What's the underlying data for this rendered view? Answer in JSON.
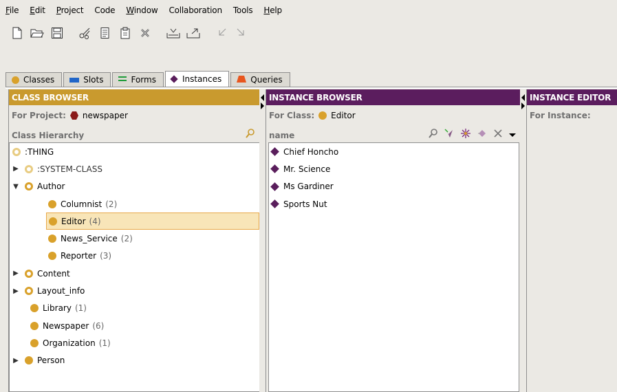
{
  "menu": [
    "File",
    "Edit",
    "Project",
    "Code",
    "Window",
    "Collaboration",
    "Tools",
    "Help"
  ],
  "toolbar_icons": [
    "new-file-icon",
    "open-folder-icon",
    "save-icon",
    "cut-icon",
    "copy-icon",
    "paste-icon",
    "delete-icon",
    "import-icon",
    "export-icon",
    "undo-icon",
    "redo-icon"
  ],
  "tabs": [
    {
      "label": "Classes",
      "icon": "class-dot",
      "active": false
    },
    {
      "label": "Slots",
      "icon": "slot-bar",
      "active": false
    },
    {
      "label": "Forms",
      "icon": "form-lines",
      "active": false
    },
    {
      "label": "Instances",
      "icon": "instance-diamond",
      "active": true
    },
    {
      "label": "Queries",
      "icon": "query-triangle",
      "active": false
    }
  ],
  "class_browser": {
    "header": "CLASS BROWSER",
    "project_label": "For Project:",
    "project_name": "newspaper",
    "hierarchy_label": "Class Hierarchy",
    "header_color": "#c99a2e",
    "rows": [
      {
        "label": ":THING",
        "count": ""
      },
      {
        "label": ":SYSTEM-CLASS",
        "count": ""
      },
      {
        "label": "Author",
        "count": ""
      },
      {
        "label": "Columnist",
        "count": "(2)"
      },
      {
        "label": "Editor",
        "count": "(4)"
      },
      {
        "label": "News_Service",
        "count": "(2)"
      },
      {
        "label": "Reporter",
        "count": "(3)"
      },
      {
        "label": "Content",
        "count": ""
      },
      {
        "label": "Layout_info",
        "count": ""
      },
      {
        "label": "Library",
        "count": "(1)"
      },
      {
        "label": "Newspaper",
        "count": "(6)"
      },
      {
        "label": "Organization",
        "count": "(1)"
      },
      {
        "label": "Person",
        "count": ""
      }
    ]
  },
  "instance_browser": {
    "header": "INSTANCE BROWSER",
    "class_label": "For Class:",
    "class_name": "Editor",
    "column_label": "name",
    "header_color": "#5b1d5e",
    "items": [
      "Chief Honcho",
      "Mr. Science",
      "Ms Gardiner",
      "Sports Nut"
    ]
  },
  "instance_editor": {
    "header": "INSTANCE EDITOR",
    "instance_label": "For Instance:",
    "header_color": "#5b1d5e"
  }
}
